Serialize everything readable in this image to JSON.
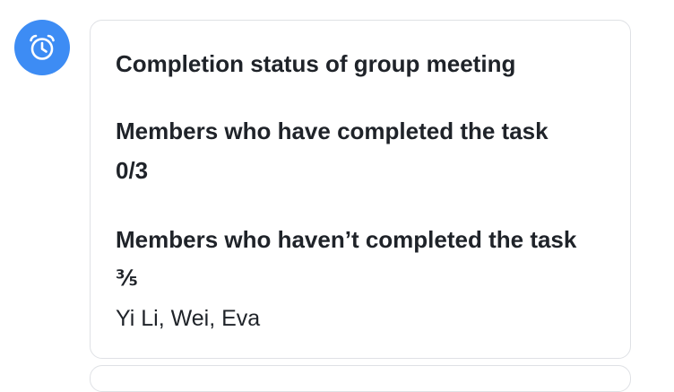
{
  "avatar": {
    "icon": "alarm-clock-icon",
    "background": "#3d8cf4"
  },
  "card": {
    "title": "Completion status of group meeting",
    "completed": {
      "label": "Members who have completed the task",
      "count": "0/3"
    },
    "pending": {
      "label": "Members who haven’t completed the task",
      "count": "⅗",
      "names": "Yi Li, Wei, Eva"
    }
  }
}
